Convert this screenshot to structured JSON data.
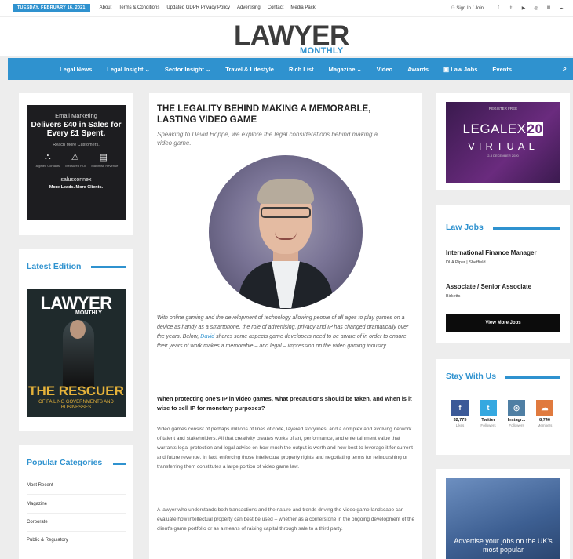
{
  "topbar": {
    "date": "TUESDAY, FEBRUARY 16, 2021",
    "links": [
      "About",
      "Terms & Conditions",
      "Updated GDPR Privacy Policy",
      "Advertising",
      "Contact",
      "Media Pack"
    ],
    "signin": "Sign In / Join",
    "social_icons": [
      "facebook-icon",
      "twitter-icon",
      "youtube-icon",
      "instagram-icon",
      "linkedin-icon",
      "soundcloud-icon"
    ]
  },
  "logo": {
    "main": "LAWYER",
    "sub": "MONTHLY"
  },
  "nav": {
    "items": [
      "Legal News",
      "Legal Insight ⌄",
      "Sector Insight ⌄",
      "Travel & Lifestyle",
      "Rich List",
      "Magazine ⌄",
      "Video",
      "Awards",
      "▣ Law Jobs",
      "Events"
    ],
    "search_icon": "⌕"
  },
  "ad_email": {
    "line1": "Email Marketing",
    "line2": "Delivers £40 in Sales for Every £1 Spent.",
    "line3": "Reach More Customers.",
    "icons": [
      "⛬",
      "⚠",
      "▤"
    ],
    "icon_labels": [
      "Targeted Contacts",
      "Measured ROI",
      "Maximise Revenue"
    ],
    "brand": "salusconnex",
    "tagline": "More Leads. More Clients."
  },
  "latest_edition": {
    "title": "Latest Edition",
    "mag_title": "LAWYER",
    "mag_sub": "MONTHLY",
    "headline": "THE RESCUER",
    "tagline": "OF FAILING GOVERNMENTS AND BUSINESSES"
  },
  "popular": {
    "title": "Popular Categories",
    "items": [
      "Most Recent",
      "Magazine",
      "Corporate",
      "Public & Regulatory"
    ]
  },
  "article": {
    "title": "THE LEGALITY BEHIND MAKING A MEMORABLE, LASTING VIDEO GAME",
    "subtitle": "Speaking to David Hoppe, we explore the legal considerations behind making a video game.",
    "intro_before": "With online gaming and the development of technology allowing people of all ages to play games on a device as handy as a smartphone, the role of advertising, privacy and IP has changed dramatically over the years. Below, ",
    "intro_link": "David",
    "intro_after": " shares some aspects game developers need to be aware of in order to ensure their years of work makes a memorable – and legal – impression on the video gaming industry.",
    "question": "When protecting one's IP in video games, what precautions should be taken, and when is it wise to sell IP for monetary purposes?",
    "para1": "Video games consist of perhaps millions of lines of code, layered storylines, and a complex and evolving network of talent and stakeholders. All that creativity creates works of art, performance, and entertainment value that warrants legal protection and legal advice on how much the output is worth and how best to leverage it for current and future revenue. In fact, enforcing those intellectual property rights and negotiating terms for relinquishing or transferring them constitutes a large portion of video game law.",
    "para2": "A lawyer who understands both transactions and the nature and trends driving the video game landscape can evaluate how intellectual property can best be used – whether as a cornerstone in the ongoing development of the client's game portfolio or as a means of raising capital through sale to a third party."
  },
  "legalex": {
    "register": "REGISTER FREE",
    "name_a": "LEGALEX",
    "name_b": "20",
    "virtual": "VIRTUAL",
    "date": "2-3 DECEMBER 2020"
  },
  "law_jobs": {
    "title": "Law Jobs",
    "jobs": [
      {
        "title": "International Finance Manager",
        "company": "DLA Piper | Sheffield"
      },
      {
        "title": "Associate / Senior Associate",
        "company": "Birketts"
      }
    ],
    "button": "View More Jobs"
  },
  "stay": {
    "title": "Stay With Us",
    "items": [
      {
        "icon": "f",
        "count": "32,775",
        "label": "Likes",
        "color": "#3b5998"
      },
      {
        "icon": "t",
        "count": "Twitter",
        "label": "Followers",
        "color": "#35a8e0"
      },
      {
        "icon": "◎",
        "count": "Instagr...",
        "label": "Followers",
        "color": "#4f7fa4"
      },
      {
        "icon": "☁",
        "count": "8,746",
        "label": "Members",
        "color": "#e07a3e"
      }
    ]
  },
  "advertise": {
    "text": "Advertise your jobs on the UK's most popular"
  }
}
